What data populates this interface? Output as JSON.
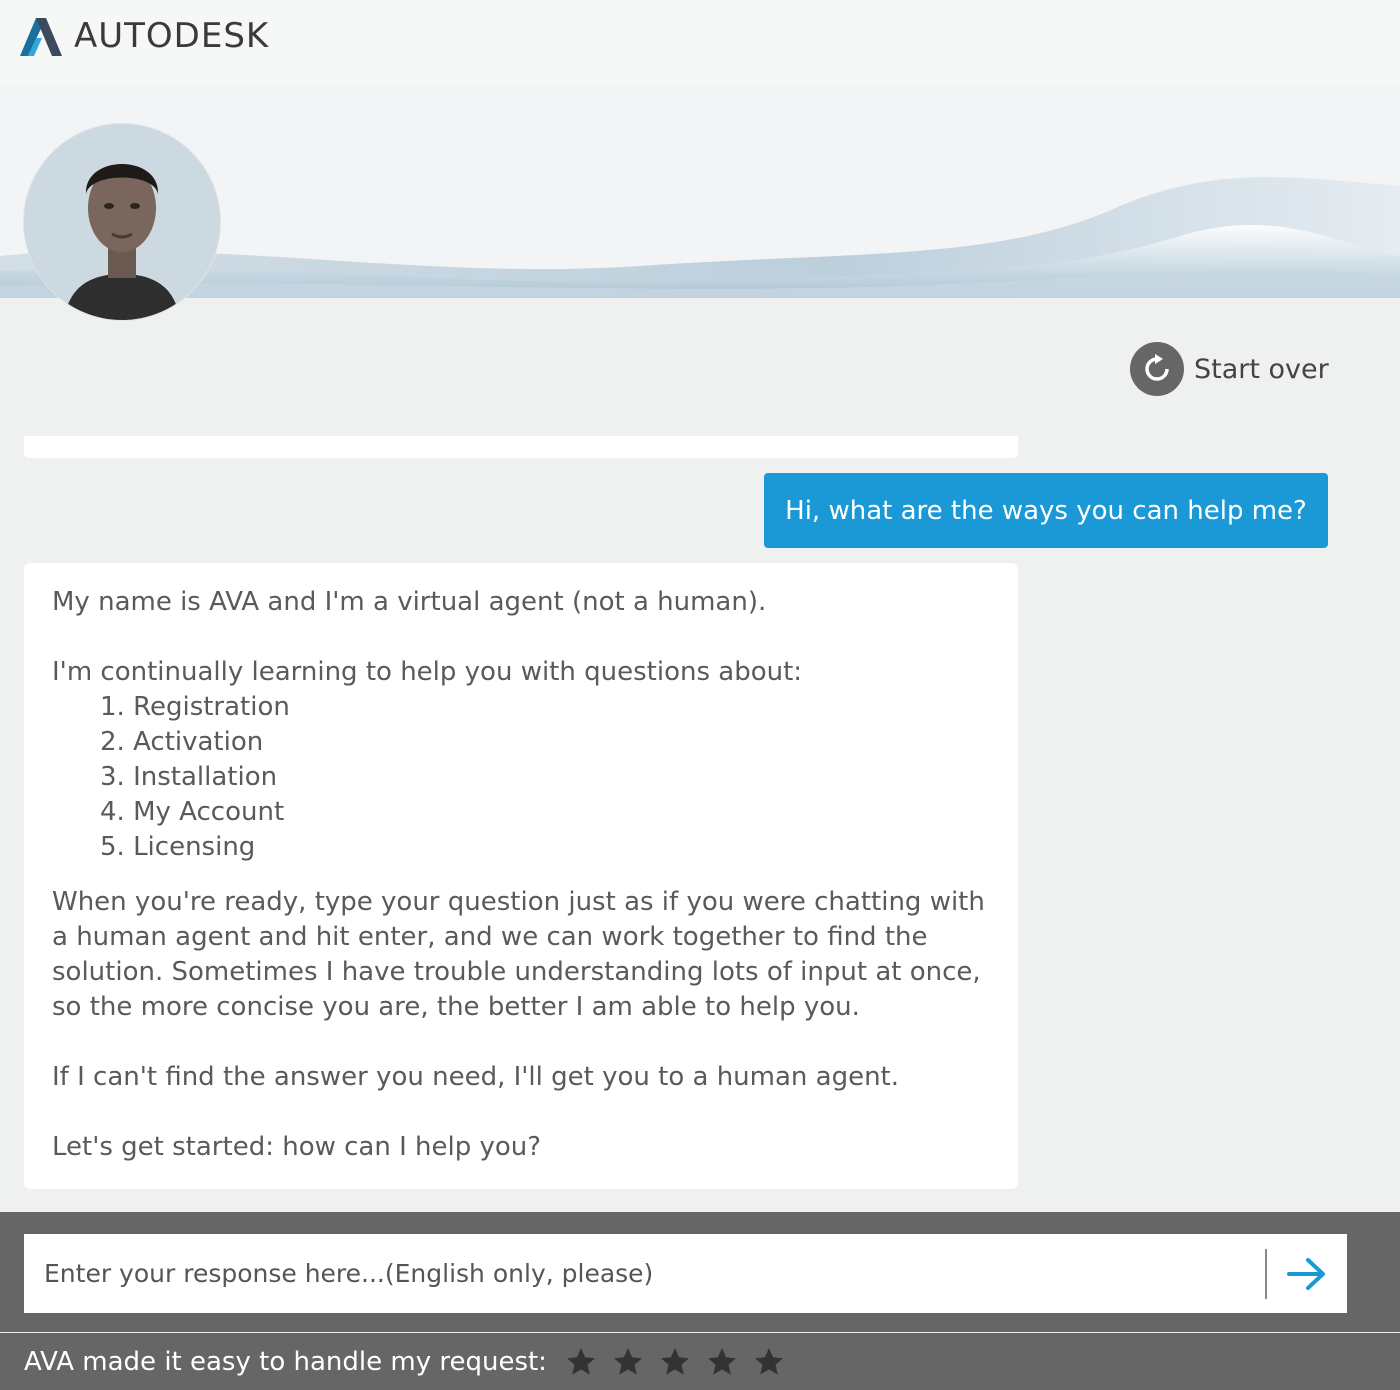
{
  "header": {
    "brand": "AUTODESK",
    "logo_icon": "autodesk-logo-icon"
  },
  "banner": {
    "avatar_icon": "agent-avatar"
  },
  "start_over": {
    "label": "Start over",
    "icon": "refresh-icon"
  },
  "conversation": {
    "user_message": "Hi, what are the ways you can help me?",
    "bot_message": {
      "intro": "My name is AVA and I'm a virtual agent (not a human).",
      "topics_lead": "I'm continually learning to help you with questions about:",
      "topics": [
        "1. Registration",
        "2. Activation",
        "3. Installation",
        "4. My Account",
        "5. Licensing"
      ],
      "instructions": "When you're ready, type your question just as if you were chatting with a human agent and hit enter, and we can work together to find the solution. Sometimes I have trouble understanding lots of input at once, so the more concise you are, the better I am able to help you.",
      "fallback": "If I can't find the answer you need, I'll get you to a human agent.",
      "closing": "Let's get started: how can I help you?"
    }
  },
  "input": {
    "placeholder": "Enter your response here...(English only, please)",
    "value": "",
    "send_icon": "arrow-right-icon"
  },
  "rating": {
    "label": "AVA made it easy to handle my request:",
    "star_count": 5,
    "selected": 0
  },
  "colors": {
    "accent": "#1b99d6",
    "footer": "#666666",
    "background": "#eff0f0"
  }
}
